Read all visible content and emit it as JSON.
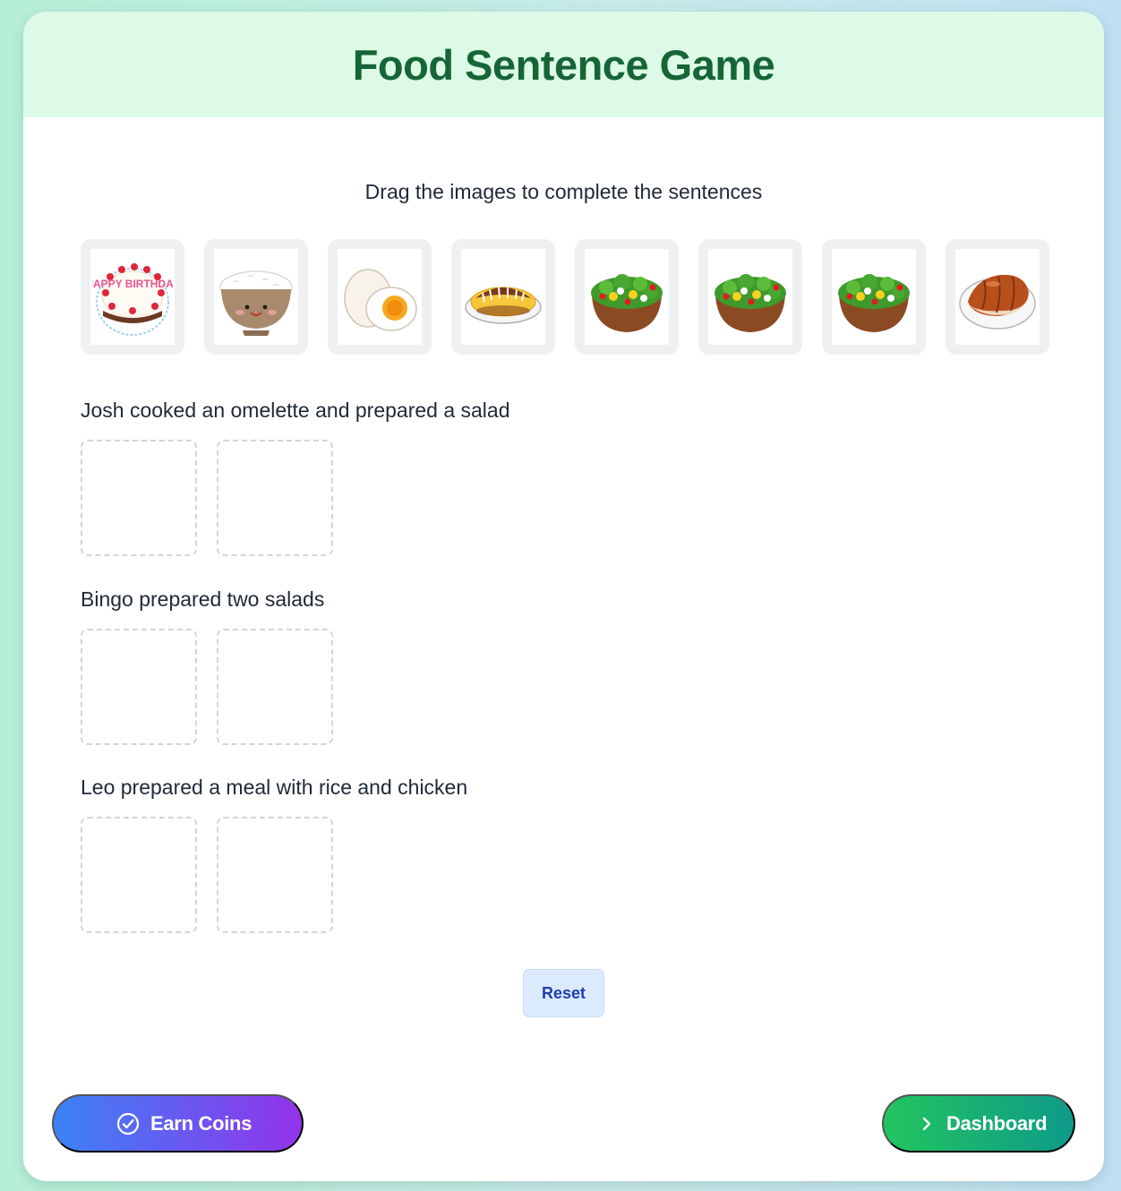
{
  "game": {
    "title": "Food Sentence Game",
    "instructions": "Drag the images to complete the sentences"
  },
  "food_bank": [
    {
      "name": "birthday-cake",
      "caption": "HAPPY BIRTHDAY"
    },
    {
      "name": "rice-bowl"
    },
    {
      "name": "boiled-egg"
    },
    {
      "name": "omelette"
    },
    {
      "name": "salad"
    },
    {
      "name": "salad"
    },
    {
      "name": "salad"
    },
    {
      "name": "chicken"
    }
  ],
  "sentences": [
    {
      "text": "Josh cooked an omelette and prepared a salad",
      "slot_count": 2
    },
    {
      "text": "Bingo prepared two salads",
      "slot_count": 2
    },
    {
      "text": "Leo prepared a meal with rice and chicken",
      "slot_count": 2
    }
  ],
  "controls": {
    "reset_label": "Reset",
    "earn_label": "Earn Coins",
    "earn_icon": "check-circle-icon",
    "dashboard_label": "Dashboard",
    "dashboard_icon": "chevron-right-icon"
  },
  "colors": {
    "title": "#166534",
    "header_bg": "#dcfae6",
    "earn_gradient": [
      "#3b82f6",
      "#9333ea"
    ],
    "dashboard_gradient": [
      "#22c55e",
      "#0f9a8a"
    ]
  }
}
